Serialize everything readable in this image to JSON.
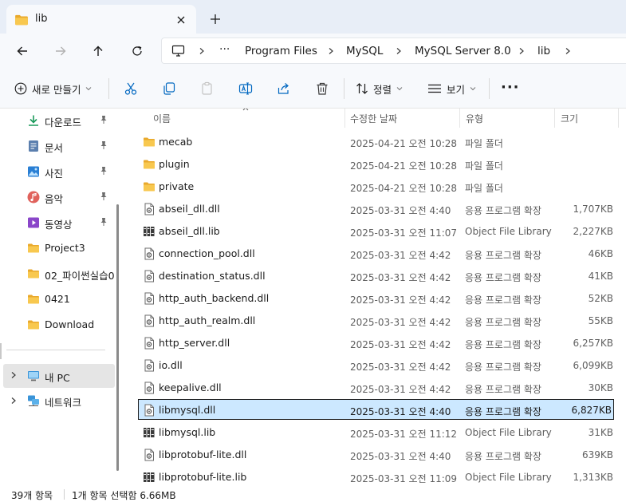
{
  "colors": {
    "accent": "#0067c0",
    "folder": "#f3c14b",
    "selected_bg": "#cce8ff"
  },
  "tab": {
    "title": "lib",
    "icon": "folder-icon"
  },
  "nav": {
    "back": "back-arrow-icon",
    "forward": "forward-arrow-icon",
    "up": "up-arrow-icon",
    "refresh": "refresh-icon"
  },
  "address": {
    "ellipsis": "···",
    "segments": [
      "Program Files",
      "MySQL",
      "MySQL Server 8.0",
      "lib"
    ]
  },
  "toolbar": {
    "new_label": "새로 만들기",
    "sort_label": "정렬",
    "view_label": "보기",
    "more": "···"
  },
  "sidebar": {
    "items": [
      {
        "label": "다운로드",
        "icon": "download-icon",
        "pinned": true
      },
      {
        "label": "문서",
        "icon": "document-icon",
        "pinned": true
      },
      {
        "label": "사진",
        "icon": "pictures-icon",
        "pinned": true
      },
      {
        "label": "음악",
        "icon": "music-icon",
        "pinned": true
      },
      {
        "label": "동영상",
        "icon": "video-icon",
        "pinned": true
      },
      {
        "label": "Project3",
        "icon": "folder-icon",
        "pinned": false
      },
      {
        "label": "02_파이썬실습0",
        "icon": "folder-icon",
        "pinned": false
      },
      {
        "label": "0421",
        "icon": "folder-icon",
        "pinned": false
      },
      {
        "label": "Download",
        "icon": "folder-icon",
        "pinned": false
      }
    ],
    "this_pc": "내 PC",
    "network": "네트워크"
  },
  "columns": {
    "name": "이름",
    "date": "수정한 날짜",
    "type": "유형",
    "size": "크기"
  },
  "files": [
    {
      "name": "mecab",
      "date": "2025-04-21 오전 10:28",
      "type": "파일 폴더",
      "size": "",
      "kind": "folder"
    },
    {
      "name": "plugin",
      "date": "2025-04-21 오전 10:28",
      "type": "파일 폴더",
      "size": "",
      "kind": "folder"
    },
    {
      "name": "private",
      "date": "2025-04-21 오전 10:28",
      "type": "파일 폴더",
      "size": "",
      "kind": "folder"
    },
    {
      "name": "abseil_dll.dll",
      "date": "2025-03-31 오전 4:40",
      "type": "응용 프로그램 확장",
      "size": "1,707KB",
      "kind": "dll"
    },
    {
      "name": "abseil_dll.lib",
      "date": "2025-03-31 오전 11:07",
      "type": "Object File Library",
      "size": "2,227KB",
      "kind": "lib"
    },
    {
      "name": "connection_pool.dll",
      "date": "2025-03-31 오전 4:42",
      "type": "응용 프로그램 확장",
      "size": "46KB",
      "kind": "dll"
    },
    {
      "name": "destination_status.dll",
      "date": "2025-03-31 오전 4:42",
      "type": "응용 프로그램 확장",
      "size": "41KB",
      "kind": "dll"
    },
    {
      "name": "http_auth_backend.dll",
      "date": "2025-03-31 오전 4:42",
      "type": "응용 프로그램 확장",
      "size": "52KB",
      "kind": "dll"
    },
    {
      "name": "http_auth_realm.dll",
      "date": "2025-03-31 오전 4:42",
      "type": "응용 프로그램 확장",
      "size": "55KB",
      "kind": "dll"
    },
    {
      "name": "http_server.dll",
      "date": "2025-03-31 오전 4:42",
      "type": "응용 프로그램 확장",
      "size": "6,257KB",
      "kind": "dll"
    },
    {
      "name": "io.dll",
      "date": "2025-03-31 오전 4:42",
      "type": "응용 프로그램 확장",
      "size": "6,099KB",
      "kind": "dll"
    },
    {
      "name": "keepalive.dll",
      "date": "2025-03-31 오전 4:42",
      "type": "응용 프로그램 확장",
      "size": "30KB",
      "kind": "dll"
    },
    {
      "name": "libmysql.dll",
      "date": "2025-03-31 오전 4:40",
      "type": "응용 프로그램 확장",
      "size": "6,827KB",
      "kind": "dll",
      "selected": true
    },
    {
      "name": "libmysql.lib",
      "date": "2025-03-31 오전 11:12",
      "type": "Object File Library",
      "size": "31KB",
      "kind": "lib"
    },
    {
      "name": "libprotobuf-lite.dll",
      "date": "2025-03-31 오전 4:40",
      "type": "응용 프로그램 확장",
      "size": "639KB",
      "kind": "dll"
    },
    {
      "name": "libprotobuf-lite.lib",
      "date": "2025-03-31 오전 11:09",
      "type": "Object File Library",
      "size": "1,313KB",
      "kind": "lib"
    }
  ],
  "status": {
    "count": "39개 항목",
    "selection": "1개 항목 선택함 6.66MB"
  }
}
